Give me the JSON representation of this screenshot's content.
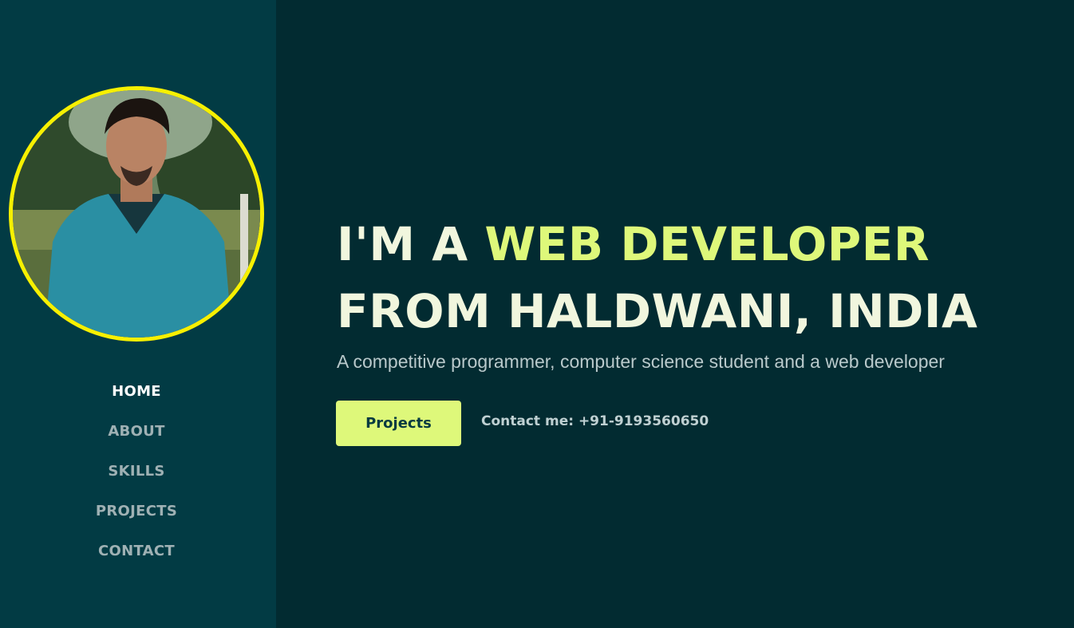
{
  "profile": {
    "photo_icon": "profile-photo",
    "ring_color": "#f7f000"
  },
  "nav": {
    "items": [
      {
        "label": "HOME",
        "active": true
      },
      {
        "label": "ABOUT"
      },
      {
        "label": "SKILLS"
      },
      {
        "label": "PROJECTS"
      },
      {
        "label": "CONTACT"
      }
    ]
  },
  "hero": {
    "line1_prefix": "I'M A ",
    "line1_highlight": "WEB DEVELOPER",
    "line2": "FROM HALDWANI, INDIA",
    "tagline": "A competitive programmer, computer science student and a web developer",
    "projects_button": "Projects",
    "contact_text": "Contact me: +91-9193560650"
  },
  "colors": {
    "sidebar_bg": "#023b44",
    "main_bg": "#022b31",
    "accent": "#def87a",
    "text_light": "#f1f6de"
  }
}
